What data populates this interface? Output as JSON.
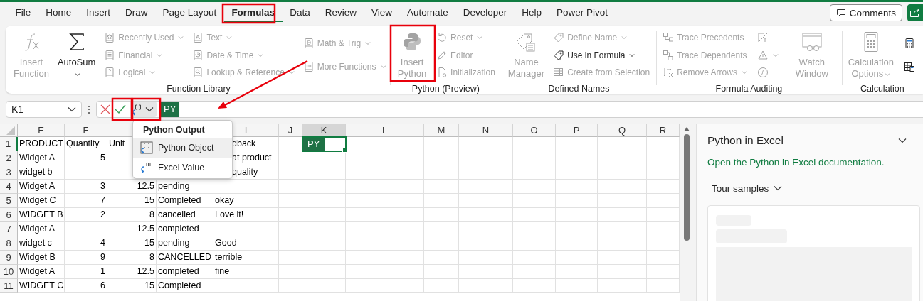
{
  "tabs": [
    {
      "label": "File",
      "selected": false
    },
    {
      "label": "Home",
      "selected": false
    },
    {
      "label": "Insert",
      "selected": false
    },
    {
      "label": "Draw",
      "selected": false
    },
    {
      "label": "Page Layout",
      "selected": false
    },
    {
      "label": "Formulas",
      "selected": true
    },
    {
      "label": "Data",
      "selected": false
    },
    {
      "label": "Review",
      "selected": false
    },
    {
      "label": "View",
      "selected": false
    },
    {
      "label": "Automate",
      "selected": false
    },
    {
      "label": "Developer",
      "selected": false
    },
    {
      "label": "Help",
      "selected": false
    },
    {
      "label": "Power Pivot",
      "selected": false
    }
  ],
  "comments_button": {
    "label": "Comments"
  },
  "ribbon": {
    "groups": [
      {
        "label": "Function Library",
        "columns": [
          {
            "kind": "large",
            "items": [
              {
                "label": "Insert Function",
                "disabled": true,
                "dropdown": false
              }
            ]
          },
          {
            "kind": "large",
            "items": [
              {
                "label": "AutoSum",
                "disabled": false,
                "dropdown": true
              }
            ]
          },
          {
            "kind": "stack",
            "items": [
              {
                "label": "Recently Used",
                "disabled": true,
                "dropdown": true
              },
              {
                "label": "Financial",
                "disabled": true,
                "dropdown": true
              },
              {
                "label": "Logical",
                "disabled": true,
                "dropdown": true
              }
            ]
          },
          {
            "kind": "stack",
            "items": [
              {
                "label": "Text",
                "disabled": true,
                "dropdown": true
              },
              {
                "label": "Date & Time",
                "disabled": true,
                "dropdown": true
              },
              {
                "label": "Lookup & Reference",
                "disabled": true,
                "dropdown": true
              }
            ]
          },
          {
            "kind": "stack",
            "items": [
              {
                "label": "Math & Trig",
                "disabled": true,
                "dropdown": true
              },
              {
                "label": "More Functions",
                "disabled": true,
                "dropdown": true
              }
            ]
          }
        ]
      },
      {
        "label": "Python (Preview)",
        "columns": [
          {
            "kind": "large",
            "items": [
              {
                "label": "Insert Python",
                "disabled": true,
                "dropdown": false
              }
            ]
          },
          {
            "kind": "stack",
            "items": [
              {
                "label": "Reset",
                "disabled": true,
                "dropdown": true
              },
              {
                "label": "Editor",
                "disabled": true,
                "dropdown": false
              },
              {
                "label": "Initialization",
                "disabled": true,
                "dropdown": false
              }
            ]
          }
        ]
      },
      {
        "label": "Defined Names",
        "columns": [
          {
            "kind": "large",
            "items": [
              {
                "label": "Name Manager",
                "disabled": true,
                "dropdown": false
              }
            ]
          },
          {
            "kind": "stack",
            "items": [
              {
                "label": "Define Name",
                "disabled": true,
                "dropdown": true
              },
              {
                "label": "Use in Formula",
                "disabled": false,
                "dropdown": true
              },
              {
                "label": "Create from Selection",
                "disabled": true,
                "dropdown": false
              }
            ]
          }
        ]
      },
      {
        "label": "Formula Auditing",
        "columns": [
          {
            "kind": "stack",
            "items": [
              {
                "label": "Trace Precedents",
                "disabled": true,
                "dropdown": false
              },
              {
                "label": "Trace Dependents",
                "disabled": true,
                "dropdown": false
              },
              {
                "label": "Remove Arrows",
                "disabled": true,
                "dropdown": true
              }
            ]
          },
          {
            "kind": "icons",
            "items": [
              {
                "disabled": true,
                "dropdown": false
              },
              {
                "disabled": true,
                "dropdown": true
              },
              {
                "disabled": true,
                "dropdown": false
              }
            ]
          },
          {
            "kind": "large",
            "items": [
              {
                "label": "Watch Window",
                "disabled": true,
                "dropdown": false
              }
            ]
          }
        ]
      },
      {
        "label": "Calculation",
        "columns": [
          {
            "kind": "large",
            "items": [
              {
                "label": "Calculation Options",
                "disabled": true,
                "dropdown": true
              }
            ]
          },
          {
            "kind": "icons",
            "items": [
              {
                "disabled": false,
                "dropdown": false
              },
              {
                "disabled": false,
                "dropdown": false
              }
            ]
          }
        ]
      }
    ]
  },
  "formula_bar": {
    "name_box": "K1",
    "more": "⋮",
    "badge": "PY"
  },
  "popup": {
    "title": "Python Output",
    "items": [
      {
        "label": "Python Object",
        "selected": true
      },
      {
        "label": "Excel Value",
        "selected": false
      }
    ]
  },
  "grid": {
    "columns": [
      {
        "label": "E",
        "selected": false
      },
      {
        "label": "F",
        "selected": false
      },
      {
        "selected": false
      },
      {},
      {
        "label": "I",
        "selected": false
      },
      {
        "label": "J",
        "selected": false
      },
      {
        "label": "K",
        "selected": true
      },
      {
        "label": "L",
        "selected": false
      },
      {
        "label": "M",
        "selected": false
      },
      {
        "label": "N",
        "selected": false
      },
      {
        "label": "O",
        "selected": false
      },
      {
        "label": "P",
        "selected": false
      },
      {
        "label": "Q",
        "selected": false
      },
      {
        "label": "R",
        "selected": false
      }
    ],
    "rows": [
      {
        "number": "1",
        "selected": true,
        "cells": [
          "PRODUCT",
          "Quantity",
          "Unit_",
          null,
          "dback",
          null,
          {
            "badge": "PY",
            "selected": true
          }
        ]
      },
      {
        "number": "2",
        "selected": false,
        "cells": [
          "Widget A",
          {
            "number": "5"
          },
          null,
          null,
          "at product"
        ]
      },
      {
        "number": "3",
        "selected": false,
        "cells": [
          "widget b",
          null,
          null,
          null,
          "quality"
        ]
      },
      {
        "number": "4",
        "selected": false,
        "cells": [
          "Widget A",
          {
            "number": "3"
          },
          {
            "number": "12.5"
          },
          "pending"
        ]
      },
      {
        "number": "5",
        "selected": false,
        "cells": [
          "Widget C",
          {
            "number": "7"
          },
          {
            "number": "15"
          },
          "Completed",
          "okay"
        ]
      },
      {
        "number": "6",
        "selected": false,
        "cells": [
          "WIDGET B",
          {
            "number": "2"
          },
          {
            "number": "8"
          },
          "cancelled",
          "Love it!"
        ]
      },
      {
        "number": "7",
        "selected": false,
        "cells": [
          "Widget A",
          null,
          {
            "number": "12.5"
          },
          "completed"
        ]
      },
      {
        "number": "8",
        "selected": false,
        "cells": [
          "widget c",
          {
            "number": "4"
          },
          {
            "number": "15"
          },
          "pending",
          "Good"
        ]
      },
      {
        "number": "9",
        "selected": false,
        "cells": [
          "Widget B",
          {
            "number": "9"
          },
          {
            "number": "8"
          },
          "CANCELLED",
          "terrible"
        ]
      },
      {
        "number": "10",
        "selected": false,
        "cells": [
          "Widget A",
          {
            "number": "1"
          },
          {
            "number": "12.5"
          },
          "completed",
          "fine"
        ]
      },
      {
        "number": "11",
        "selected": false,
        "cells": [
          "WIDGET C",
          {
            "number": "6"
          },
          {
            "number": "15"
          },
          "Completed"
        ]
      }
    ]
  },
  "pane": {
    "title": "Python in Excel",
    "link": "Open the Python in Excel documentation.",
    "samples_label": "Tour samples"
  }
}
